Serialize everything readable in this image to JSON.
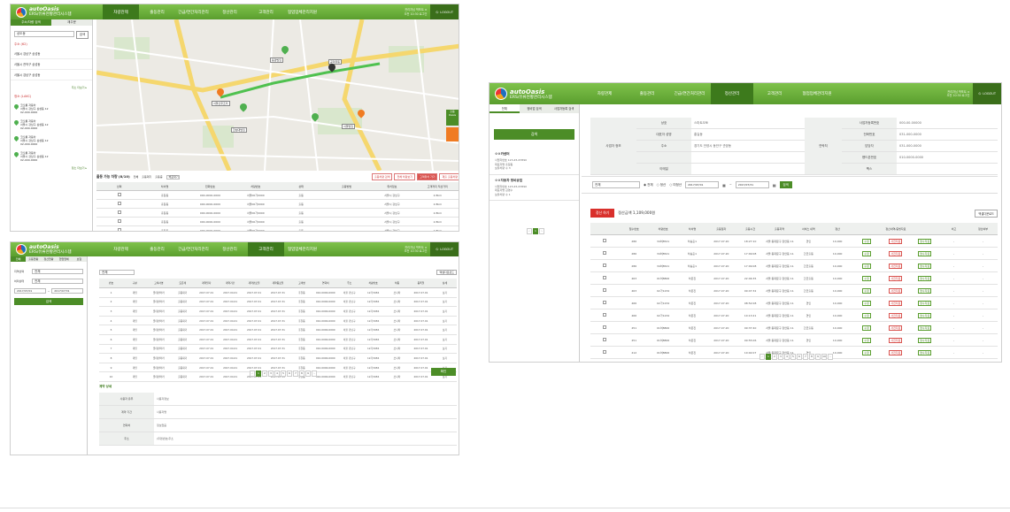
{
  "brand": {
    "name": "autoOasis",
    "subtitle": "ERS/유류현황관리시스템"
  },
  "shot1": {
    "menu": [
      "차량관제",
      "출동관리",
      "긴급/연간처리관리",
      "정산관리",
      "고객관리",
      "협업업체관리지원"
    ],
    "active_menu": "차량관제",
    "user_line1": "관리자님 박포트 ⊙",
    "user_line2": "오전 10:30 로그인",
    "logout": "LOGOUT",
    "side_tabs": [
      "주소/차량 검색",
      "재주문"
    ],
    "search_placeholder": "상도동",
    "search_button": "검색",
    "side_section1": "주소 (62)",
    "side_addresses": [
      "서울시 강남구 삼성동",
      "서울시 관악구 삼성동",
      "서울시 강남구 삼성동"
    ],
    "more1": "주소 더보기 ▸",
    "side_section2": "정소 (LAKC)",
    "side_places": [
      {
        "name": "코오롱 자동차",
        "line1": "서울시 강남구 삼성동 12",
        "phone": "02-000-0000"
      },
      {
        "name": "코오롱 자동차",
        "line1": "서울시 강남구 삼성동 12",
        "phone": "02-000-0000"
      },
      {
        "name": "코오롱 자동차",
        "line1": "서울시 강남구 삼성동 12",
        "phone": "02-000-0000"
      },
      {
        "name": "코오롱 자동차",
        "line1": "서울시 강남구 삼성동 12",
        "phone": "02-000-0000"
      }
    ],
    "more2": "정소 더보기 ▸",
    "map_labels": [
      "동양빌딩",
      "공덕유동",
      "서울산후조리",
      "한성대빌딩",
      "서울빌딩"
    ],
    "map_side_btn": "출동 Oasis",
    "status_title": "출동 가능 차량 (8/10)",
    "status_options": [
      "전체",
      "출동대기",
      "출동중"
    ],
    "status_filter": "배포대기",
    "map_buttons": [
      "출동차량 검색",
      "전체 차량보기",
      "고객위치 가기",
      "재출 출동차량"
    ],
    "table_headers": [
      "선택",
      "차서명",
      "전화번호",
      "차량번호",
      "상태",
      "출동방법",
      "위치정보",
      "고객까지 직선거리"
    ],
    "table_rows": [
      [
        "",
        "홍길동",
        "000-0000-0000",
        "서울00가0000",
        "출동",
        "",
        "서울시 강남구",
        "2.8km"
      ],
      [
        "",
        "홍길동",
        "000-0000-0000",
        "서울00가0000",
        "출동",
        "",
        "서울시 강남구",
        "2.8km"
      ],
      [
        "",
        "홍길동",
        "000-0000-0000",
        "서울00가0000",
        "출동",
        "",
        "서울시 강남구",
        "2.8km"
      ],
      [
        "",
        "홍길동",
        "000-0000-0000",
        "서울00가0000",
        "출동",
        "",
        "서울시 강남구",
        "2.8km"
      ],
      [
        "",
        "홍길동",
        "000-0000-0000",
        "서울00가0000",
        "출동",
        "",
        "서울시 강남구",
        "2.8km"
      ]
    ]
  },
  "shot2": {
    "menu": [
      "차량관제",
      "출동관리",
      "긴급/연간처리관리",
      "정산관리",
      "고객관리",
      "협업업체관리지원"
    ],
    "active_menu": "고객관리",
    "user_line1": "관리자님 박포트 ⊙",
    "user_line2": "오전 10:30 로그인",
    "logout": "LOGOUT",
    "side_tabs": [
      "전체",
      "출동현황",
      "정산현황",
      "협업업체",
      "보험"
    ],
    "filter_labels": [
      "지역선택",
      "처리상태"
    ],
    "filter_values": [
      "전체",
      "전체"
    ],
    "date_from": "2017/07/01",
    "date_to": "2017/07/31",
    "search_button": "검색",
    "top_select": "전체",
    "excel_btn": "엑셀다운로드",
    "table_headers": [
      "번호",
      "구분",
      "고객사명",
      "요금제",
      "계약일자",
      "계약기간",
      "계약만료일",
      "계약종료일",
      "고객명",
      "연락처",
      "주소",
      "차량번호",
      "차종",
      "등록일",
      "상세"
    ],
    "table_rows": [
      [
        "1",
        "개인",
        "롯데렌터카",
        "출동대기",
        "2017.07.01",
        "2017.04.01",
        "2017.07.01",
        "2017.07.31",
        "홍길동",
        "010-0000-0000",
        "서울 강남구",
        "12가3456",
        "쏘나타",
        "2017.07.01",
        "보기"
      ],
      [
        "2",
        "개인",
        "롯데렌터카",
        "출동대기",
        "2017.07.01",
        "2017.04.01",
        "2017.07.01",
        "2017.07.31",
        "홍길동",
        "010-0000-0000",
        "서울 강남구",
        "12가3456",
        "쏘나타",
        "2017.07.01",
        "보기"
      ],
      [
        "3",
        "개인",
        "롯데렌터카",
        "출동대기",
        "2017.07.01",
        "2017.04.01",
        "2017.07.01",
        "2017.07.31",
        "홍길동",
        "010-0000-0000",
        "서울 강남구",
        "12가3456",
        "쏘나타",
        "2017.07.01",
        "보기"
      ],
      [
        "4",
        "개인",
        "롯데렌터카",
        "출동대기",
        "2017.07.01",
        "2017.04.01",
        "2017.07.01",
        "2017.07.31",
        "홍길동",
        "010-0000-0000",
        "서울 강남구",
        "12가3456",
        "쏘나타",
        "2017.07.01",
        "보기"
      ],
      [
        "5",
        "개인",
        "롯데렌터카",
        "출동대기",
        "2017.07.01",
        "2017.04.01",
        "2017.07.01",
        "2017.07.31",
        "홍길동",
        "010-0000-0000",
        "서울 강남구",
        "12가3456",
        "쏘나타",
        "2017.07.01",
        "보기"
      ],
      [
        "6",
        "개인",
        "롯데렌터카",
        "출동대기",
        "2017.07.01",
        "2017.04.01",
        "2017.07.01",
        "2017.07.31",
        "홍길동",
        "010-0000-0000",
        "서울 강남구",
        "12가3456",
        "쏘나타",
        "2017.07.01",
        "보기"
      ],
      [
        "7",
        "개인",
        "롯데렌터카",
        "출동대기",
        "2017.07.01",
        "2017.04.01",
        "2017.07.01",
        "2017.07.31",
        "홍길동",
        "010-0000-0000",
        "서울 강남구",
        "12가3456",
        "쏘나타",
        "2017.07.01",
        "보기"
      ],
      [
        "8",
        "개인",
        "롯데렌터카",
        "출동대기",
        "2017.07.01",
        "2017.04.01",
        "2017.07.01",
        "2017.07.31",
        "홍길동",
        "010-0000-0000",
        "서울 강남구",
        "12가3456",
        "쏘나타",
        "2017.07.01",
        "보기"
      ],
      [
        "9",
        "개인",
        "롯데렌터카",
        "출동대기",
        "2017.07.01",
        "2017.04.01",
        "2017.07.01",
        "2017.07.31",
        "홍길동",
        "010-0000-0000",
        "서울 강남구",
        "12가3456",
        "쏘나타",
        "2017.07.01",
        "보기"
      ],
      [
        "10",
        "개인",
        "롯데렌터카",
        "출동대기",
        "2017.07.01",
        "2017.04.01",
        "2017.07.01",
        "2017.07.31",
        "홍길동",
        "010-0000-0000",
        "서울 강남구",
        "12가3456",
        "쏘나타",
        "2017.07.01",
        "보기"
      ]
    ],
    "pages": [
      "‹",
      "1",
      "2",
      "3",
      "4",
      "5",
      "6",
      "7",
      "8",
      "9",
      "›"
    ],
    "active_page": "1",
    "confirm_btn": "확인",
    "detail_title": "계약 상세",
    "detail_rows": [
      [
        "사용자 유무",
        "사용자정보"
      ],
      [
        "계약 기간",
        "사용자명"
      ],
      [
        "연락처",
        "정보없음"
      ],
      [
        "주소",
        "(우편번호)주소"
      ]
    ]
  },
  "shot3": {
    "menu": [
      "차량관제",
      "출동관리",
      "긴급/연간처리관리",
      "정산관리",
      "고객관리",
      "협업업체관리지원"
    ],
    "active_menu": "정산관리",
    "user_line1": "관리자님 박포트 ⊙",
    "user_line2": "오전 10:30 로그인",
    "logout": "LOGOUT",
    "side_tabs": [
      "전체",
      "정비업 검색",
      "사업자등록 검색"
    ],
    "search_button": "검색",
    "side_groups": [
      {
        "title": "ㅇㅇ카센터",
        "lines": [
          "사업자번호 123-45-67890",
          "대표자명 홍길동",
          "보유차량 수 3"
        ]
      },
      {
        "title": "ㅇㅇ자동차 정비공업",
        "lines": [
          "사업자번호 123-45-67890",
          "대표자명 김영수",
          "보유차량 수 1"
        ]
      }
    ],
    "side_pager": [
      "‹",
      "1",
      "›"
    ],
    "info_label": "사업자 정보",
    "info_rows": [
      {
        "k1": "상호",
        "v1": "스마트오토",
        "k2": "사업자등록번호",
        "v2": "000-00-00000"
      },
      {
        "k1": "대표자 성명",
        "v1": "홍길동",
        "k2": "전화번호",
        "v2": "031-000-0000"
      },
      {
        "k1": "주소",
        "v1": "경기도 안양시 동안구 관양동",
        "k2": "담당자",
        "v2": "031-000-0000"
      },
      {
        "k1": "",
        "v1": "",
        "k2": "핸드폰번호",
        "v2": "010-0000-0000"
      },
      {
        "k1": "이메일",
        "v1": "",
        "k2": "팩스",
        "v2": ""
      }
    ],
    "contact_label": "연락처",
    "filter_select": "전체",
    "radio_options": [
      "전체",
      "정산",
      "미정산"
    ],
    "date_from": "2017/07/01",
    "date_to": "2017/07/31",
    "filter_search": "검색",
    "total_btn": "정산 하기",
    "total_label": "정산금액 1,109,000원",
    "excel_btn": "엑셀다운로드",
    "table_headers": [
      "",
      "접수번호",
      "차량번호",
      "차서명",
      "출동일자",
      "출동시간",
      "출동지역",
      "서비스 내역",
      "정산",
      "",
      "정산내역/증빙자료",
      "",
      "비고",
      "정산여부"
    ],
    "table_rows": [
      [
        "",
        "286",
        "34허8521",
        "차승훈1",
        "2017.07.20",
        "18:27:10",
        "서울 동대문구 장안동 11-27",
        "견인",
        "10,000",
        "수정",
        "사진자료",
        "영수자료",
        "-",
        "-"
      ],
      [
        "",
        "286",
        "34허8521",
        "차승훈1",
        "2017.07.20",
        "17:09:08",
        "서울 동대문구 장안동 11-27",
        "긴급출동",
        "10,000",
        "수정",
        "사진자료",
        "영수자료",
        "-",
        "-"
      ],
      [
        "",
        "286",
        "34허8521",
        "차승훈1",
        "2017.07.20",
        "17:09:08",
        "서울 동대문구 장안동 11-27",
        "긴급출동",
        "10,000",
        "수정",
        "사진자료",
        "영수자료",
        "-",
        "-"
      ],
      [
        "",
        "463",
        "01허8806",
        "차은진",
        "2017.07.20",
        "22:46:35",
        "서울 동대문구 장안동 11-27",
        "긴급출동",
        "10,000",
        "수정",
        "사진자료",
        "영수자료",
        "-",
        "-"
      ],
      [
        "",
        "463",
        "02가1234",
        "차은진",
        "2017.07.20",
        "09:47:32",
        "서울 동대문구 장안동 11-27",
        "긴급출동",
        "10,000",
        "수정",
        "사진자료",
        "영수자료",
        "-",
        "-"
      ],
      [
        "",
        "466",
        "02가1234",
        "차은진",
        "2017.07.20",
        "08:52:08",
        "서울 동대문구 장안동 11-27",
        "견인",
        "10,000",
        "수정",
        "사진자료",
        "영수자료",
        "-",
        "-"
      ],
      [
        "",
        "466",
        "02가1234",
        "차은진",
        "2017.07.20",
        "10:13:21",
        "서울 동대문구 장안동 11-27",
        "견인",
        "10,000",
        "수정",
        "사진자료",
        "영수자료",
        "-",
        "-"
      ],
      [
        "",
        "451",
        "01허8806",
        "차은진",
        "2017.07.20",
        "09:37:40",
        "서울 동대문구 장안동 11-27",
        "긴급출동",
        "10,000",
        "수정",
        "사진자료",
        "영수자료",
        "-",
        "-"
      ],
      [
        "",
        "451",
        "01허8806",
        "차은진",
        "2017.07.20",
        "09:55:06",
        "서울 동대문구 장안동 11-27",
        "견인",
        "10,000",
        "수정",
        "사진자료",
        "영수자료",
        "-",
        "-"
      ],
      [
        "",
        "412",
        "01허8806",
        "차은진",
        "2017.07.20",
        "10:02:07",
        "서울 동대문구 장안동 11-27",
        "견인",
        "10,000",
        "수정",
        "사진자료",
        "영수자료",
        "-",
        "-"
      ],
      [
        "",
        "454",
        "30허8857",
        "차은진",
        "2017.07.20",
        "10:05:40",
        "서울 동대문구 장안동 11-27",
        "견인",
        "10,000",
        "수정",
        "사진자료",
        "영수자료",
        "-",
        "-"
      ]
    ],
    "pages": [
      "‹",
      "1",
      "2",
      "3",
      "4",
      "5",
      "6",
      "7",
      "8",
      "9",
      "10",
      "›"
    ],
    "active_page": "1"
  }
}
